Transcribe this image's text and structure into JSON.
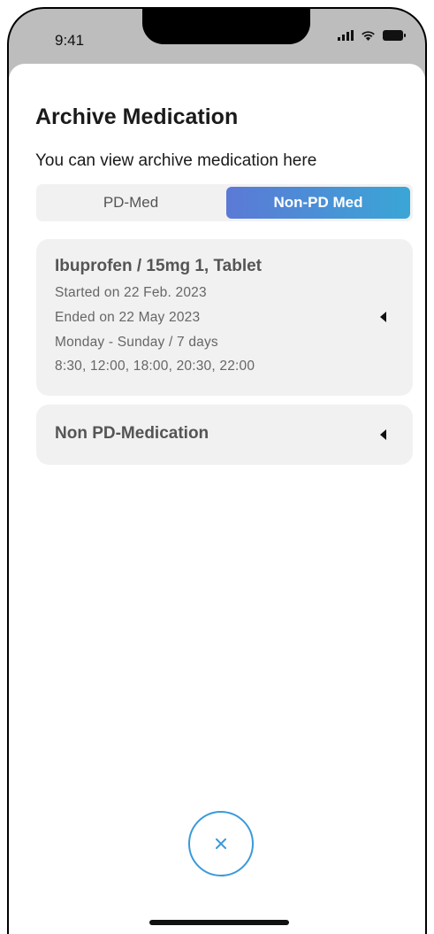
{
  "status_bar": {
    "time": "9:41",
    "icons": [
      "signal-icon",
      "wifi-icon",
      "battery-icon"
    ]
  },
  "page": {
    "title": "Archive Medication",
    "subtitle": "You can view archive medication here"
  },
  "segments": {
    "pd_label": "PD-Med",
    "non_pd_label": "Non-PD Med",
    "selected": "Non-PD Med"
  },
  "cards": [
    {
      "title": "Ibuprofen / 15mg 1, Tablet",
      "lines": [
        "Started on 22 Feb. 2023",
        "Ended on 22 May 2023",
        "Monday - Sunday / 7 days",
        "8:30, 12:00, 18:00, 20:30, 22:00"
      ]
    },
    {
      "title": "Non PD-Medication",
      "lines": []
    }
  ],
  "close_button": {
    "icon": "close-icon"
  },
  "colors": {
    "accent_start": "#5b79d6",
    "accent_end": "#3aa6d6",
    "close_ring": "#3a9ad9",
    "card_bg": "#f1f1f1"
  }
}
